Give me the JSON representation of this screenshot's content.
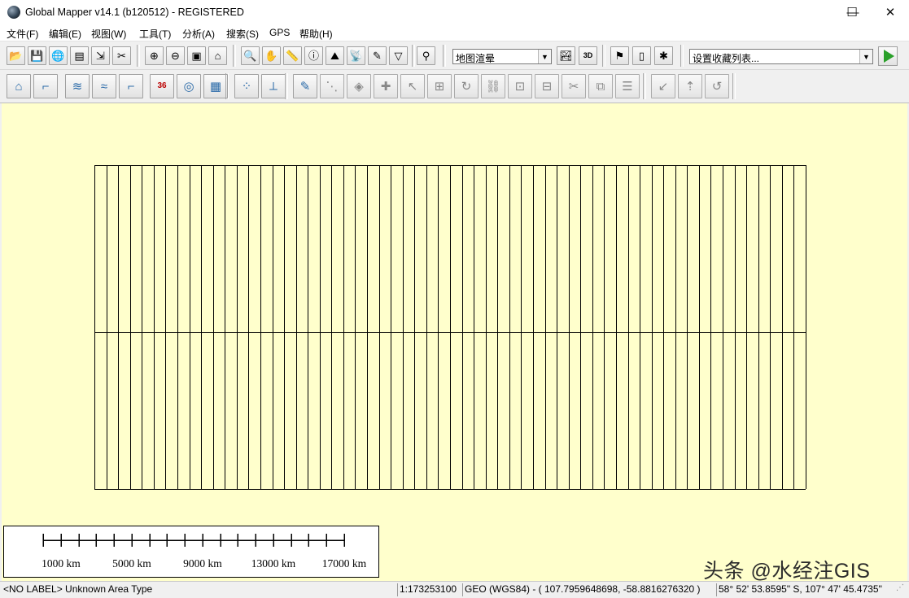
{
  "window": {
    "title": "Global Mapper v14.1 (b120512) - REGISTERED",
    "controls": {
      "minimize": "—",
      "maximize": "☐",
      "close": "✕"
    }
  },
  "menu": [
    "文件(F)",
    "编辑(E)",
    "视图(W)",
    "工具(T)",
    "分析(A)",
    "搜索(S)",
    "GPS",
    "帮助(H)"
  ],
  "toolbar1": {
    "file_buttons": [
      {
        "name": "open-icon",
        "glyph": "📂"
      },
      {
        "name": "save-icon",
        "glyph": "💾"
      },
      {
        "name": "online-data-icon",
        "glyph": "🌐"
      },
      {
        "name": "print-icon",
        "glyph": "▤"
      },
      {
        "name": "export-icon",
        "glyph": "⇲"
      },
      {
        "name": "tools-icon",
        "glyph": "✂"
      }
    ],
    "zoom_buttons": [
      {
        "name": "zoom-in-icon",
        "glyph": "⊕"
      },
      {
        "name": "zoom-out-icon",
        "glyph": "⊖"
      },
      {
        "name": "zoom-extent-icon",
        "glyph": "▣"
      },
      {
        "name": "home-icon",
        "glyph": "⌂"
      }
    ],
    "mode_buttons": [
      {
        "name": "zoom-tool-icon",
        "glyph": "🔍"
      },
      {
        "name": "pan-tool-icon",
        "glyph": "✋"
      },
      {
        "name": "measure-tool-icon",
        "glyph": "📏"
      },
      {
        "name": "feature-info-icon",
        "glyph": "ⓘ"
      },
      {
        "name": "path-profile-icon",
        "glyph": "⛰"
      },
      {
        "name": "view-shed-icon",
        "glyph": "📡"
      },
      {
        "name": "digitizer-icon",
        "glyph": "✎"
      },
      {
        "name": "filter-icon",
        "glyph": "▽"
      }
    ],
    "search_button": {
      "name": "binoculars-icon",
      "glyph": "⚲"
    },
    "render_combo": "地图渲晕",
    "view3d_buttons": [
      {
        "name": "shader-icon",
        "glyph": "🏞"
      },
      {
        "name": "3d-view-icon",
        "glyph": "3D"
      }
    ],
    "gps_buttons": [
      {
        "name": "gps-flag-icon",
        "glyph": "⚑"
      },
      {
        "name": "gps-device-icon",
        "glyph": "▯"
      },
      {
        "name": "gps-track-icon",
        "glyph": "✱"
      }
    ],
    "bookmark_combo": "设置收藏列表...",
    "play_button": "▶"
  },
  "toolbar2": {
    "buttons": [
      {
        "name": "create-area-icon",
        "glyph": "⌂"
      },
      {
        "name": "create-line-icon",
        "glyph": "⌐"
      },
      {
        "name": "contour-icon",
        "glyph": "≋"
      },
      {
        "name": "watershed-icon",
        "glyph": "≈"
      },
      {
        "name": "edit-line-icon",
        "glyph": "⌐"
      },
      {
        "name": "coordinate-code-icon",
        "glyph": "36"
      },
      {
        "name": "buffer-icon",
        "glyph": "◎"
      },
      {
        "name": "grid-icon",
        "glyph": "▦"
      },
      {
        "name": "point-tool-icon",
        "glyph": "⁘"
      },
      {
        "name": "split-icon",
        "glyph": "⟂"
      },
      {
        "name": "digitize-icon",
        "glyph": "✎"
      },
      {
        "name": "vertex-icon",
        "glyph": "⋱"
      },
      {
        "name": "area-edit-icon",
        "glyph": "◈"
      },
      {
        "name": "add-vertex-icon",
        "glyph": "✚"
      },
      {
        "name": "move-icon",
        "glyph": "↖"
      },
      {
        "name": "merge-icon",
        "glyph": "⊞"
      },
      {
        "name": "rotate-icon",
        "glyph": "↻"
      },
      {
        "name": "link-icon",
        "glyph": "⛓"
      },
      {
        "name": "crop-icon",
        "glyph": "⊡"
      },
      {
        "name": "split-area-icon",
        "glyph": "⊟"
      },
      {
        "name": "cut-icon",
        "glyph": "✂"
      },
      {
        "name": "combine-icon",
        "glyph": "⧉"
      },
      {
        "name": "stack-icon",
        "glyph": "☰"
      },
      {
        "name": "undo-move-icon",
        "glyph": "↙"
      },
      {
        "name": "up-move-icon",
        "glyph": "⇡"
      },
      {
        "name": "redo-icon",
        "glyph": "↺"
      }
    ]
  },
  "scalebar": {
    "labels": [
      "1000 km",
      "5000 km",
      "9000 km",
      "13000 km",
      "17000 km"
    ]
  },
  "watermark": "头条 @水经注GIS",
  "status": {
    "label": "<NO LABEL> Unknown Area Type",
    "scale": "1:173253100",
    "projection": "GEO (WGS84) - ( 107.7959648698, -58.8816276320 )",
    "dms": "58° 52' 53.8595\" S, 107° 47' 45.4735\""
  }
}
